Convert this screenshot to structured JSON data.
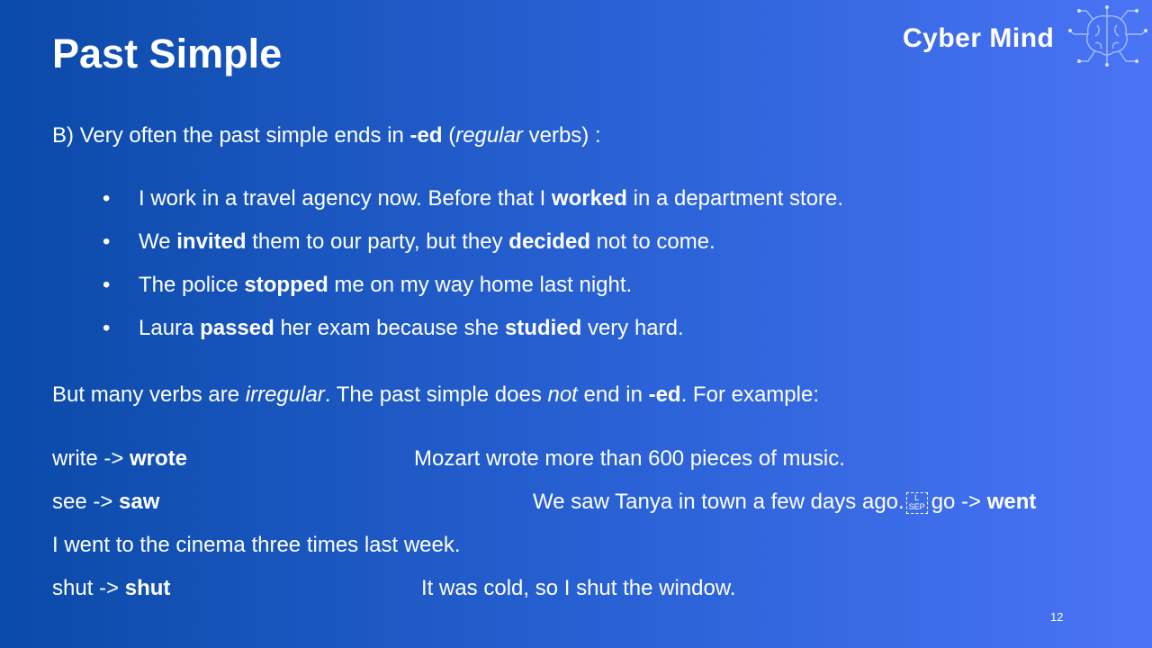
{
  "slide": {
    "title": "Past Simple",
    "page_number": "12"
  },
  "logo": {
    "text": "Cyber Mind",
    "icon": "brain-circuit-icon"
  },
  "intro": {
    "prefix": "B) Very often the past simple ends in ",
    "ed": "-ed",
    "open_paren": " (",
    "regular": "regular",
    "suffix": " verbs) :"
  },
  "bullets": [
    {
      "a": "I work in a travel agency now. Before that I ",
      "b": "worked",
      "c": " in a department store.",
      "d": "",
      "e": ""
    },
    {
      "a": "We ",
      "b": "invited",
      "c": " them to our party, but they ",
      "d": "decided",
      "e": " not to come."
    },
    {
      "a": "The police ",
      "b": "stopped",
      "c": " me on my way home last night.",
      "d": "",
      "e": ""
    },
    {
      "a": "Laura ",
      "b": "passed",
      "c": " her exam because she ",
      "d": "studied",
      "e": " very hard."
    }
  ],
  "bullet_char": "•",
  "irregular": {
    "prefix": "But many verbs are ",
    "irregular": "irregular",
    "middle": ". The past simple does ",
    "not": "not",
    "middle2": " end in ",
    "ed": "-ed",
    "suffix": ". For example:"
  },
  "examples": {
    "write": {
      "base": "write -> ",
      "past": "wrote",
      "sentence": "Mozart wrote more than 600 pieces of music."
    },
    "see": {
      "base": "see -> ",
      "past": "saw",
      "sentence": "We saw Tanya in town a few days ago.",
      "sep_top": "L",
      "sep_bottom": "SEP",
      "go_base": "go -> ",
      "go_past": "went"
    },
    "went_sentence": "I went to the cinema three times last week.",
    "shut": {
      "base": "shut -> ",
      "past": "shut",
      "sentence": "It was cold, so I shut the window."
    }
  }
}
